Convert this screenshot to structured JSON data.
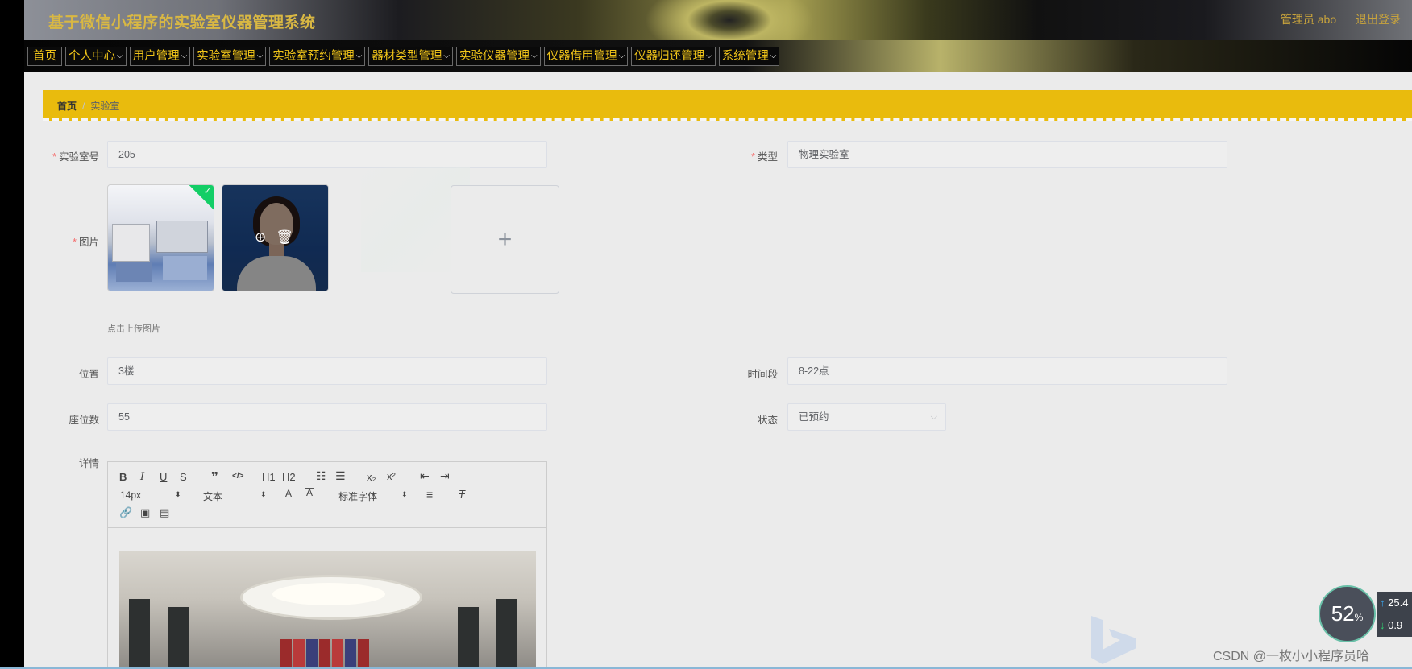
{
  "app": {
    "title": "基于微信小程序的实验室仪器管理系统",
    "user": "管理员 abo",
    "logout": "退出登录"
  },
  "nav": {
    "items": [
      "首页",
      "个人中心",
      "用户管理",
      "实验室管理",
      "实验室预约管理",
      "器材类型管理",
      "实验仪器管理",
      "仪器借用管理",
      "仪器归还管理",
      "系统管理"
    ]
  },
  "breadcrumb": {
    "home": "首页",
    "separator": "/",
    "current": "实验室"
  },
  "form": {
    "lab_no": {
      "label": "实验室号",
      "value": "205"
    },
    "type": {
      "label": "类型",
      "value": "物理实验室"
    },
    "image": {
      "label": "图片",
      "hint": "点击上传图片"
    },
    "location": {
      "label": "位置",
      "value": "3楼"
    },
    "time_slot": {
      "label": "时间段",
      "value": "8-22点"
    },
    "seats": {
      "label": "座位数",
      "value": "55"
    },
    "status": {
      "label": "状态",
      "value": "已预约"
    },
    "detail": {
      "label": "详情"
    }
  },
  "editor": {
    "font_size": "14px",
    "block_format": "文本",
    "font_family": "标准字体",
    "buttons": [
      "B",
      "I",
      "U",
      "S",
      "❞",
      "</>",
      "H1",
      "H2",
      "ol",
      "ul",
      "x₂",
      "x²",
      "outdent",
      "indent",
      "color",
      "background",
      "align",
      "clean",
      "link",
      "image",
      "video"
    ]
  },
  "overlay": {
    "progress_percent": "52",
    "percent_sign": "%",
    "upload_speed": "25.4",
    "download_speed": "0.9"
  },
  "watermark": "CSDN @一枚小小程序员哈"
}
